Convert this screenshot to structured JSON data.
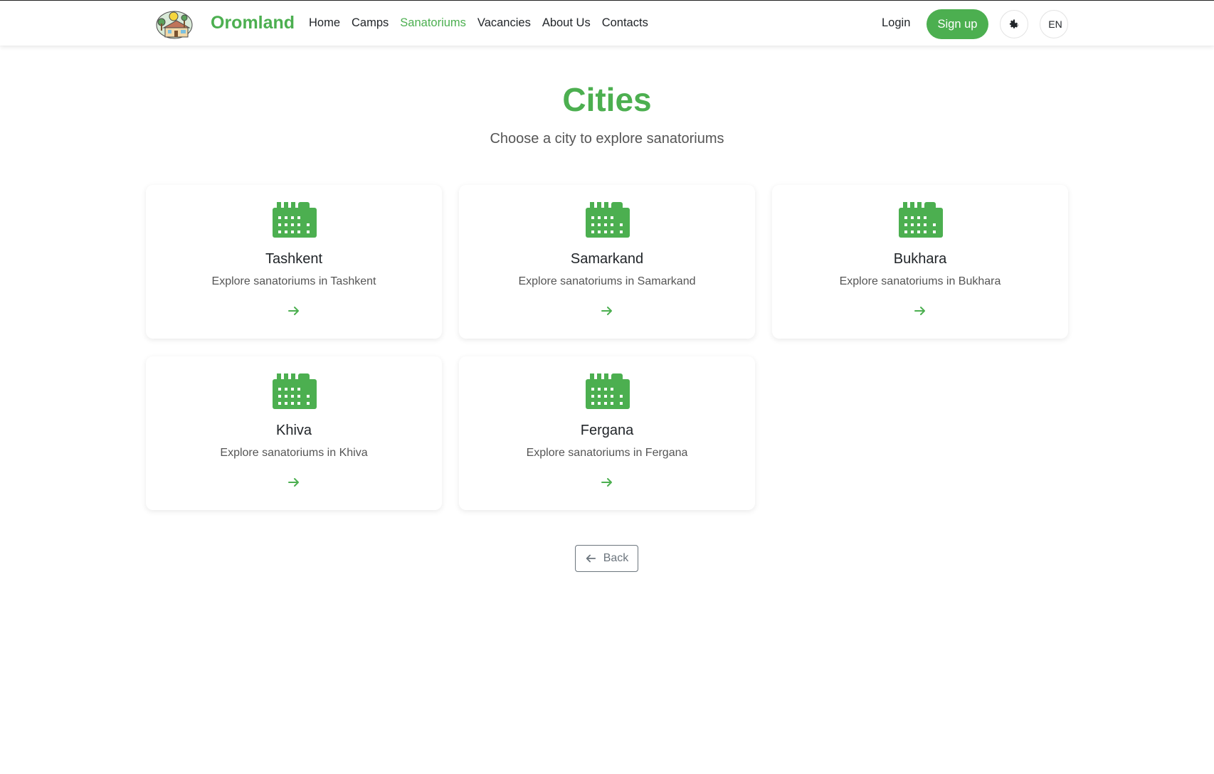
{
  "header": {
    "brand": "Oromland",
    "nav": [
      "Home",
      "Camps",
      "Sanatoriums",
      "Vacancies",
      "About Us",
      "Contacts"
    ],
    "active_nav": "Sanatoriums",
    "login_label": "Login",
    "signup_label": "Sign up",
    "theme_icon": "gear-icon",
    "language": "EN"
  },
  "main": {
    "title": "Cities",
    "subtitle": "Choose a city to explore sanatoriums",
    "cities": [
      {
        "name": "Tashkent",
        "description": "Explore sanatoriums in Tashkent"
      },
      {
        "name": "Samarkand",
        "description": "Explore sanatoriums in Samarkand"
      },
      {
        "name": "Bukhara",
        "description": "Explore sanatoriums in Bukhara"
      },
      {
        "name": "Khiva",
        "description": "Explore sanatoriums in Khiva"
      },
      {
        "name": "Fergana",
        "description": "Explore sanatoriums in Fergana"
      }
    ],
    "back_label": "Back"
  },
  "colors": {
    "accent": "#4caf50",
    "text": "#212529",
    "muted": "#555555",
    "secondary": "#6c757d"
  }
}
